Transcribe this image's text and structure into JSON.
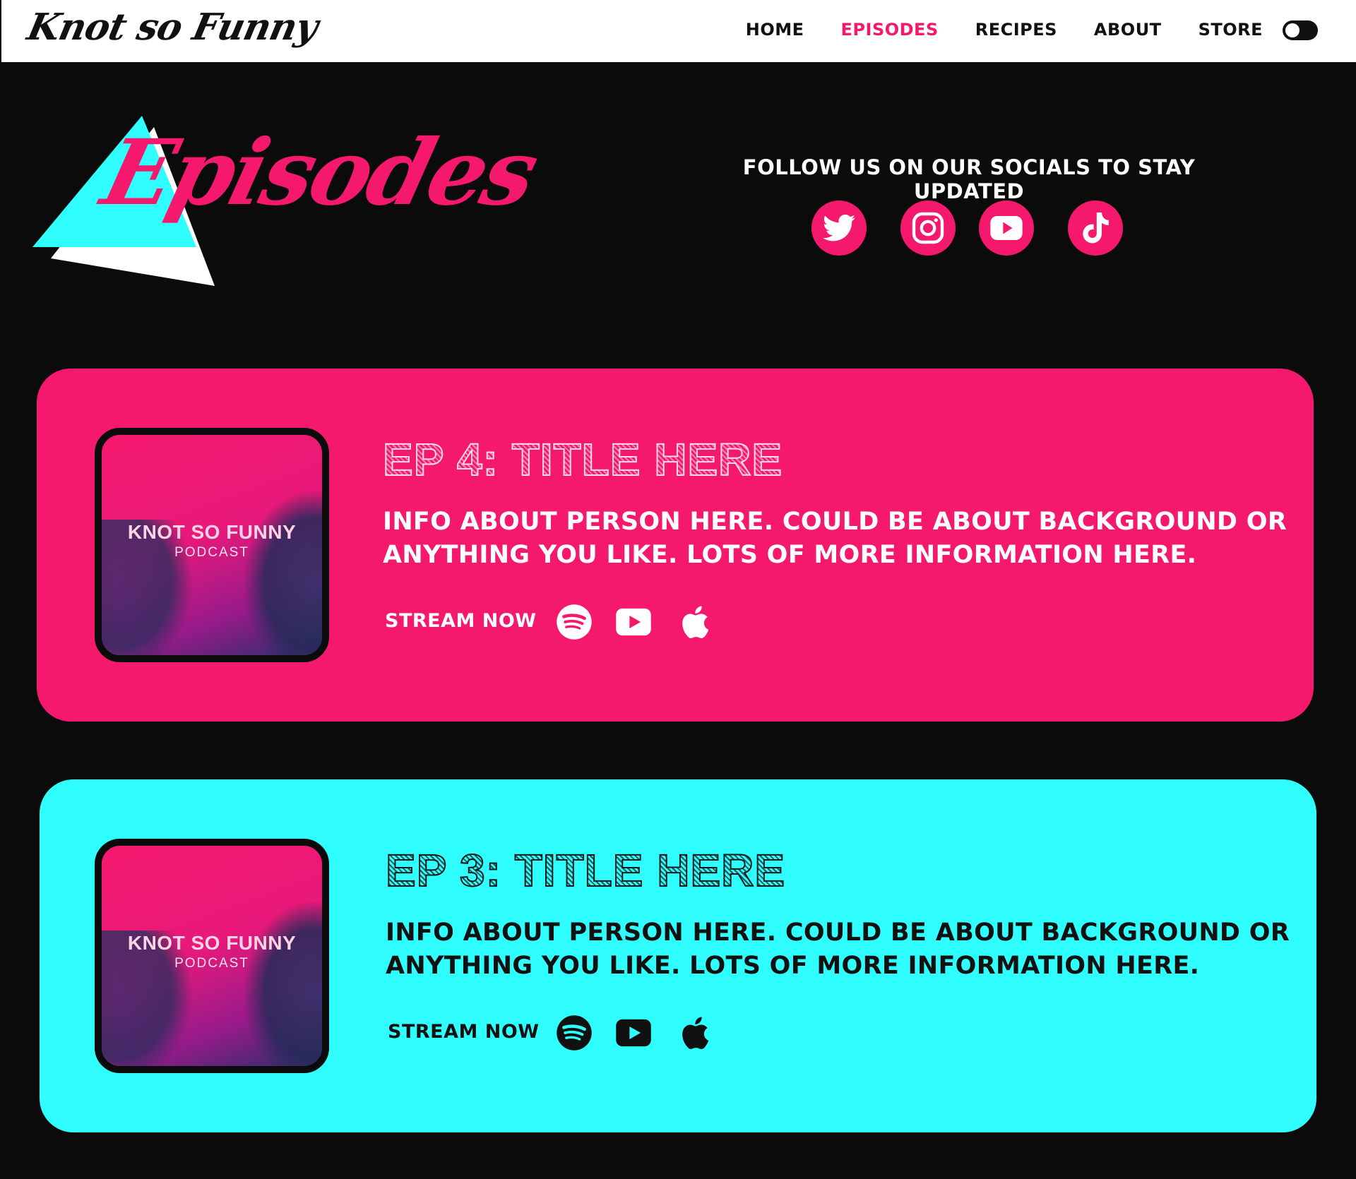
{
  "nav": {
    "logo": "Knot so Funny",
    "links": [
      "HOME",
      "EPISODES",
      "RECIPES",
      "ABOUT",
      "STORE"
    ],
    "active_index": 1,
    "theme_toggle": "dark"
  },
  "hero": {
    "title": "Episodes",
    "follow_text": "FOLLOW US ON OUR SOCIALS TO STAY UPDATED",
    "socials": [
      "twitter-icon",
      "instagram-icon",
      "youtube-icon",
      "tiktok-icon"
    ]
  },
  "colors": {
    "pink": "#f5196d",
    "cyan": "#30fdfd",
    "background": "#0b0b0b"
  },
  "episodes": [
    {
      "title": "EP 4: TITLE HERE",
      "description": "INFO ABOUT PERSON HERE. COULD BE ABOUT BACKGROUND OR ANYTHING YOU LIKE. LOTS OF MORE INFORMATION HERE.",
      "art_title": "KNOT SO FUNNY",
      "art_subtitle": "PODCAST",
      "stream_label": "STREAM NOW",
      "platforms": [
        "spotify-icon",
        "youtube-icon",
        "apple-icon"
      ],
      "theme": "pink"
    },
    {
      "title": "EP 3: TITLE HERE",
      "description": "INFO ABOUT PERSON HERE. COULD BE ABOUT BACKGROUND OR ANYTHING YOU LIKE. LOTS OF MORE INFORMATION HERE.",
      "art_title": "KNOT SO FUNNY",
      "art_subtitle": "PODCAST",
      "stream_label": "STREAM NOW",
      "platforms": [
        "spotify-icon",
        "youtube-icon",
        "apple-icon"
      ],
      "theme": "cyan"
    }
  ]
}
